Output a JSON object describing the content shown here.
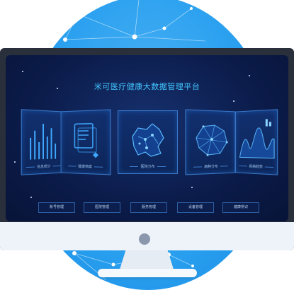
{
  "platform": {
    "title": "米可医疗健康大数据管理平台"
  },
  "cards": [
    {
      "label": "信息统计",
      "icon": "bar-chart-icon"
    },
    {
      "label": "健康档案",
      "icon": "document-icon"
    },
    {
      "label": "医院分布",
      "icon": "map-icon"
    },
    {
      "label": "病种分布",
      "icon": "network-map-icon"
    },
    {
      "label": "疾病趋势",
      "icon": "trend-chart-icon"
    }
  ],
  "nav": [
    {
      "label": "账号管理"
    },
    {
      "label": "医院管理"
    },
    {
      "label": "服务管理"
    },
    {
      "label": "设备管理"
    },
    {
      "label": "健康常识"
    }
  ],
  "colors": {
    "accent": "#42c7ff",
    "screen_bg": "#0b1b49",
    "backdrop": "#2aa0ef"
  }
}
